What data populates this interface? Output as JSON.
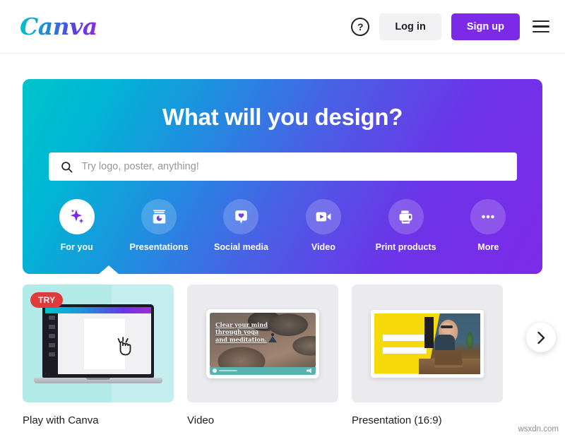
{
  "header": {
    "logo_text": "Canva",
    "help_label": "?",
    "login_label": "Log in",
    "signup_label": "Sign up",
    "menu_label": "Menu"
  },
  "hero": {
    "title": "What will you design?",
    "search": {
      "placeholder": "Try logo, poster, anything!",
      "value": ""
    },
    "categories": [
      {
        "label": "For you",
        "icon": "sparkle-icon",
        "active": true
      },
      {
        "label": "Presentations",
        "icon": "presentation-icon",
        "active": false
      },
      {
        "label": "Social media",
        "icon": "heart-bubble-icon",
        "active": false
      },
      {
        "label": "Video",
        "icon": "video-camera-icon",
        "active": false
      },
      {
        "label": "Print products",
        "icon": "printer-icon",
        "active": false
      },
      {
        "label": "More",
        "icon": "ellipsis-icon",
        "active": false
      }
    ]
  },
  "cards": [
    {
      "label": "Play with Canva",
      "badge": "TRY"
    },
    {
      "label": "Video",
      "badge": ""
    },
    {
      "label": "Presentation (16:9)",
      "badge": ""
    }
  ],
  "video_thumb_text": "Clear your mind through yoga and meditation.",
  "carousel": {
    "next_label": "›"
  },
  "watermark": "wsxdn.com",
  "colors": {
    "brand_purple": "#7d2ae8",
    "brand_teal": "#00c4cc",
    "try_red": "#e03a3a",
    "card_bg": "#ebebef",
    "play_card_bg": "#b2eae8",
    "presentation_yellow": "#f5d90a"
  }
}
